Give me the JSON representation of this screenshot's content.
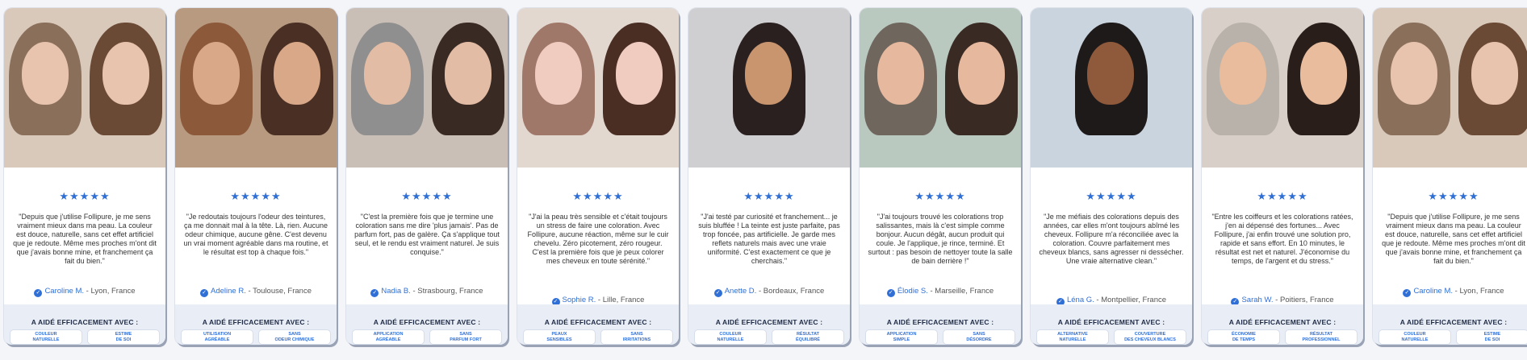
{
  "section_title": "A AIDÉ EFFICACEMENT AVEC :",
  "stars": "★★★★★",
  "check_icon": "✓",
  "cards": [
    {
      "quote": "\"Depuis que j'utilise Follipure, je me sens vraiment mieux dans ma peau. La couleur est douce, naturelle, sans cet effet artificiel que je redoute. Même mes proches m'ont dit que j'avais bonne mine, et franchement ça fait du bien.\"",
      "name": "Caroline M.",
      "location": " - Lyon, France",
      "tags": [
        "COULEUR\nNATURELLE",
        "ESTIME\nDE SOI"
      ],
      "colors": [
        "#8a6f5a",
        "#6b4a35"
      ]
    },
    {
      "quote": "\"Je redoutais toujours l'odeur des teintures, ça me donnait mal à la tête. Là, rien. Aucune odeur chimique, aucune gêne. C'est devenu un vrai moment agréable dans ma routine, et le résultat est top à chaque fois.\"",
      "name": "Adeline R.",
      "location": " - Toulouse, France",
      "tags": [
        "UTILISATION\nAGRÉABLE",
        "SANS\nODEUR CHIMIQUE"
      ],
      "colors": [
        "#8c5a3a",
        "#4a3024"
      ]
    },
    {
      "quote": "\"C'est la première fois que je termine une coloration sans me dire 'plus jamais'. Pas de parfum fort, pas de galère. Ça s'applique tout seul, et le rendu est vraiment naturel. Je suis conquise.\"",
      "name": "Nadia B.",
      "location": " - Strasbourg, France",
      "tags": [
        "APPLICATION\nAGRÉABLE",
        "SANS\nPARFUM FORT"
      ],
      "colors": [
        "#8f8f8f",
        "#3a2a24"
      ]
    },
    {
      "quote": "\"J'ai la peau très sensible et c'était toujours un stress de faire une coloration. Avec Follipure, aucune réaction, même sur le cuir chevelu. Zéro picotement, zéro rougeur. C'est la première fois que je peux colorer mes cheveux en toute sérénité.\"",
      "name": "Sophie R.",
      "location": " - Lille, France",
      "tags": [
        "PEAUX\nSENSIBLES",
        "SANS\nIRRITATIONS"
      ],
      "colors": [
        "#a0786a",
        "#4a2e24"
      ]
    },
    {
      "quote": "\"J'ai testé par curiosité et franchement... je suis bluffée ! La teinte est juste parfaite, pas trop foncée, pas artificielle. Je garde mes reflets naturels mais avec une vraie uniformité. C'est exactement ce que je cherchais.\"",
      "name": "Anette D.",
      "location": " - Bordeaux, France",
      "tags": [
        "COULEUR\nNATURELLE",
        "RÉSULTAT\nÉQUILIBRÉ"
      ],
      "colors": [
        "#2a2020"
      ]
    },
    {
      "quote": "\"J'ai toujours trouvé les colorations trop salissantes, mais là c'est simple comme bonjour. Aucun dégât, aucun produit qui coule. Je l'applique, je rince, terminé. Et surtout : pas besoin de nettoyer toute la salle de bain derrière !\"",
      "name": "Élodie S.",
      "location": " - Marseille, France",
      "tags": [
        "APPLICATION\nSIMPLE",
        "SANS\nDÉSORDRE"
      ],
      "colors": [
        "#6f665e",
        "#3a2a24"
      ]
    },
    {
      "quote": "\"Je me méfiais des colorations depuis des années, car elles m'ont toujours abîmé les cheveux. Follipure m'a réconciliée avec la coloration. Couvre parfaitement mes cheveux blancs, sans agresser ni dessécher. Une vraie alternative clean.\"",
      "name": "Léna G.",
      "location": " - Montpellier, France",
      "tags": [
        "ALTERNATIVE\nNATURELLE",
        "COUVERTURE\nDES CHEVEUX BLANCS"
      ],
      "colors": [
        "#1e1a1a"
      ]
    },
    {
      "quote": "\"Entre les coiffeurs et les colorations ratées, j'en ai dépensé des fortunes... Avec Follipure, j'ai enfin trouvé une solution pro, rapide et sans effort. En 10 minutes, le résultat est net et naturel. J'économise du temps, de l'argent et du stress.\"",
      "name": "Sarah W.",
      "location": " - Poitiers, France",
      "tags": [
        "ÉCONOMIE\nDE TEMPS",
        "RÉSULTAT\nPROFESSIONNEL"
      ],
      "colors": [
        "#b8b2aa",
        "#2a1e1a"
      ]
    },
    {
      "quote": "\"Depuis que j'utilise Follipure, je me sens vraiment mieux dans ma peau. La couleur est douce, naturelle, sans cet effet artificiel que je redoute. Même mes proches m'ont dit que j'avais bonne mine, et franchement ça fait du bien.\"",
      "name": "Caroline M.",
      "location": " - Lyon, France",
      "tags": [
        "COULEUR\nNATURELLE",
        "ESTIME\nDE SOI"
      ],
      "colors": [
        "#8a6f5a",
        "#6b4a35"
      ]
    }
  ]
}
